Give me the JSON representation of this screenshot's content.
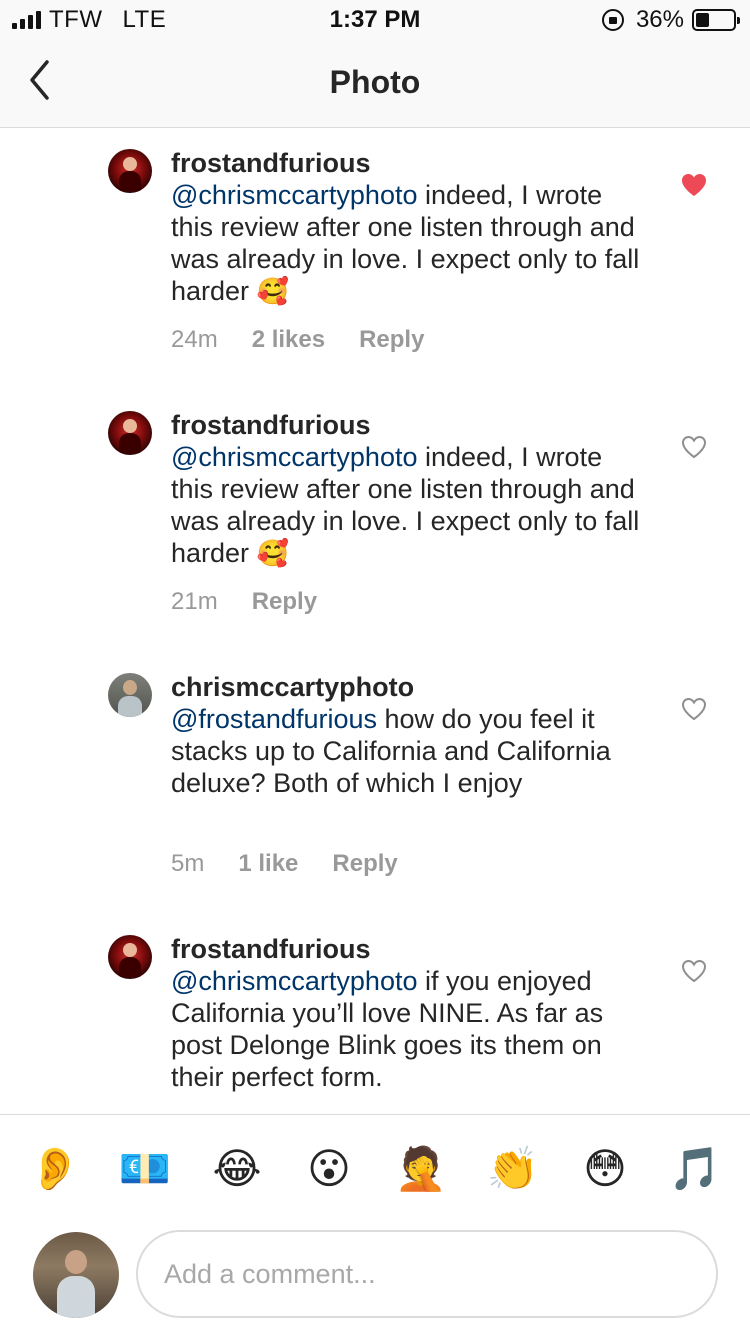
{
  "status_bar": {
    "carrier": "TFW",
    "network": "LTE",
    "time": "1:37 PM",
    "battery": "36%",
    "battery_level": 0.36
  },
  "nav": {
    "title": "Photo"
  },
  "comments": [
    {
      "username": "frostandfurious",
      "mention": "@chrismccartyphoto",
      "text": " indeed, I wrote this review after one listen through and was already in love. I expect only to fall harder ",
      "emoji": "🥰",
      "time": "24m",
      "likes": "2 likes",
      "reply": "Reply",
      "liked": true
    },
    {
      "username": "frostandfurious",
      "mention": "@chrismccartyphoto",
      "text": " indeed, I wrote this review after one listen through and was already in love. I expect only to fall harder ",
      "emoji": "🥰",
      "time": "21m",
      "reply": "Reply",
      "liked": false
    },
    {
      "username": "chrismccartyphoto",
      "mention": "@frostandfurious",
      "text": " how do you feel it stacks up to California and California deluxe? Both of which I enjoy",
      "time": "5m",
      "likes": "1 like",
      "reply": "Reply",
      "liked": false
    },
    {
      "username": "frostandfurious",
      "mention": "@chrismccartyphoto",
      "text": " if you enjoyed California you’ll love NINE. As far as post Delonge Blink goes its them on their perfect form.",
      "liked": false
    }
  ],
  "emoji_bar": [
    "👂",
    "💶",
    "😂",
    "😮",
    "🤦",
    "👏",
    "😳",
    "🎵"
  ],
  "composer": {
    "placeholder": "Add a comment..."
  },
  "colors": {
    "liked_heart": "#ed4956",
    "mention": "#003569",
    "meta": "#999999"
  }
}
